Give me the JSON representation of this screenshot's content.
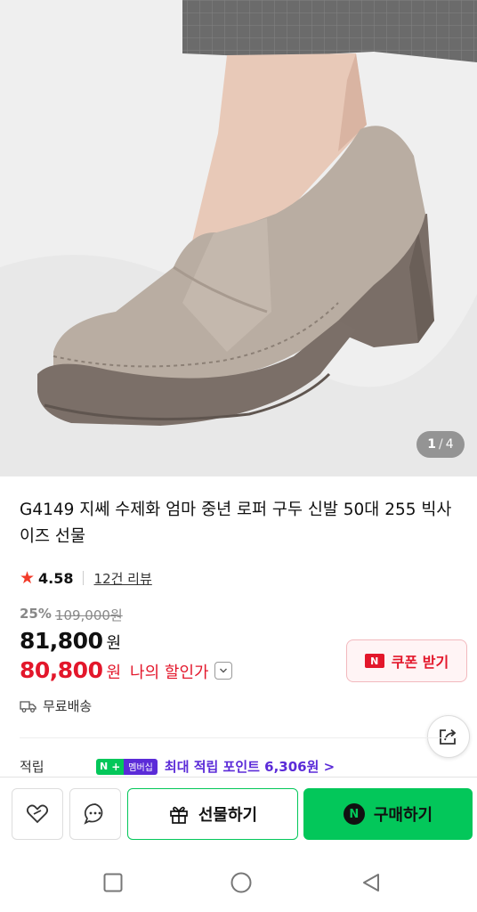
{
  "image": {
    "alt": "product-photo-taupe-loafer",
    "page_current": "1",
    "page_separator": "/",
    "page_total": "4"
  },
  "product": {
    "title": "G4149 지쎄 수제화 엄마 중년 로퍼 구두 신발 50대 255 빅사이즈 선물",
    "rating": "4.58",
    "reviews": "12건 리뷰",
    "discount_pct": "25%",
    "original_price": "109,000원",
    "price": "81,800",
    "price_unit": "원",
    "my_price": "80,800",
    "my_price_unit": "원",
    "my_price_label": "나의 할인가"
  },
  "coupon": {
    "badge": "N",
    "label": "쿠폰 받기"
  },
  "shipping": {
    "label": "무료배송"
  },
  "points": {
    "label": "적립",
    "badge_n": "N",
    "badge_plus": "+",
    "badge_membership": "멤버십",
    "text": "최대 적립 포인트 6,306원 >"
  },
  "actions": {
    "gift_label": "선물하기",
    "buy_badge": "N",
    "buy_label": "구매하기"
  },
  "colors": {
    "naver_green": "#03c75a",
    "sale_red": "#e3172b",
    "membership_purple": "#5b2bd8",
    "star": "#f23b2a"
  }
}
